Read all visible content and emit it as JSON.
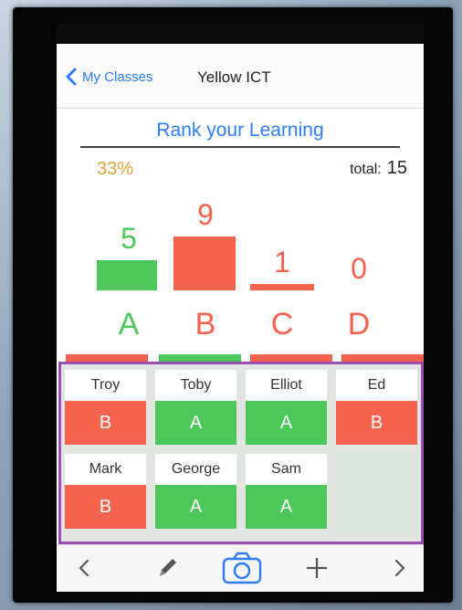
{
  "nav": {
    "back_label": "My Classes",
    "title": "Yellow ICT"
  },
  "rank": {
    "title": "Rank your Learning",
    "percent": "33%",
    "total_label": "total:",
    "total_value": "15"
  },
  "colors": {
    "green": "#4cc85a",
    "red": "#f5624e",
    "blue": "#2d7cf6",
    "orange": "#e0a43c",
    "purple": "#9b4fb2"
  },
  "chart_data": {
    "type": "bar",
    "categories": [
      "A",
      "B",
      "C",
      "D"
    ],
    "values": [
      5,
      9,
      1,
      0
    ],
    "colors": [
      "green",
      "red",
      "red",
      "red"
    ]
  },
  "students": [
    {
      "name": "Troy",
      "grade": "B"
    },
    {
      "name": "Toby",
      "grade": "A"
    },
    {
      "name": "Elliot",
      "grade": "A"
    },
    {
      "name": "Ed",
      "grade": "B"
    },
    {
      "name": "Mark",
      "grade": "B"
    },
    {
      "name": "George",
      "grade": "A"
    },
    {
      "name": "Sam",
      "grade": "A"
    }
  ],
  "toolbar": {
    "icons": [
      "chevron-left-icon",
      "pencil-icon",
      "camera-icon",
      "plus-icon",
      "chevron-right-icon"
    ]
  }
}
